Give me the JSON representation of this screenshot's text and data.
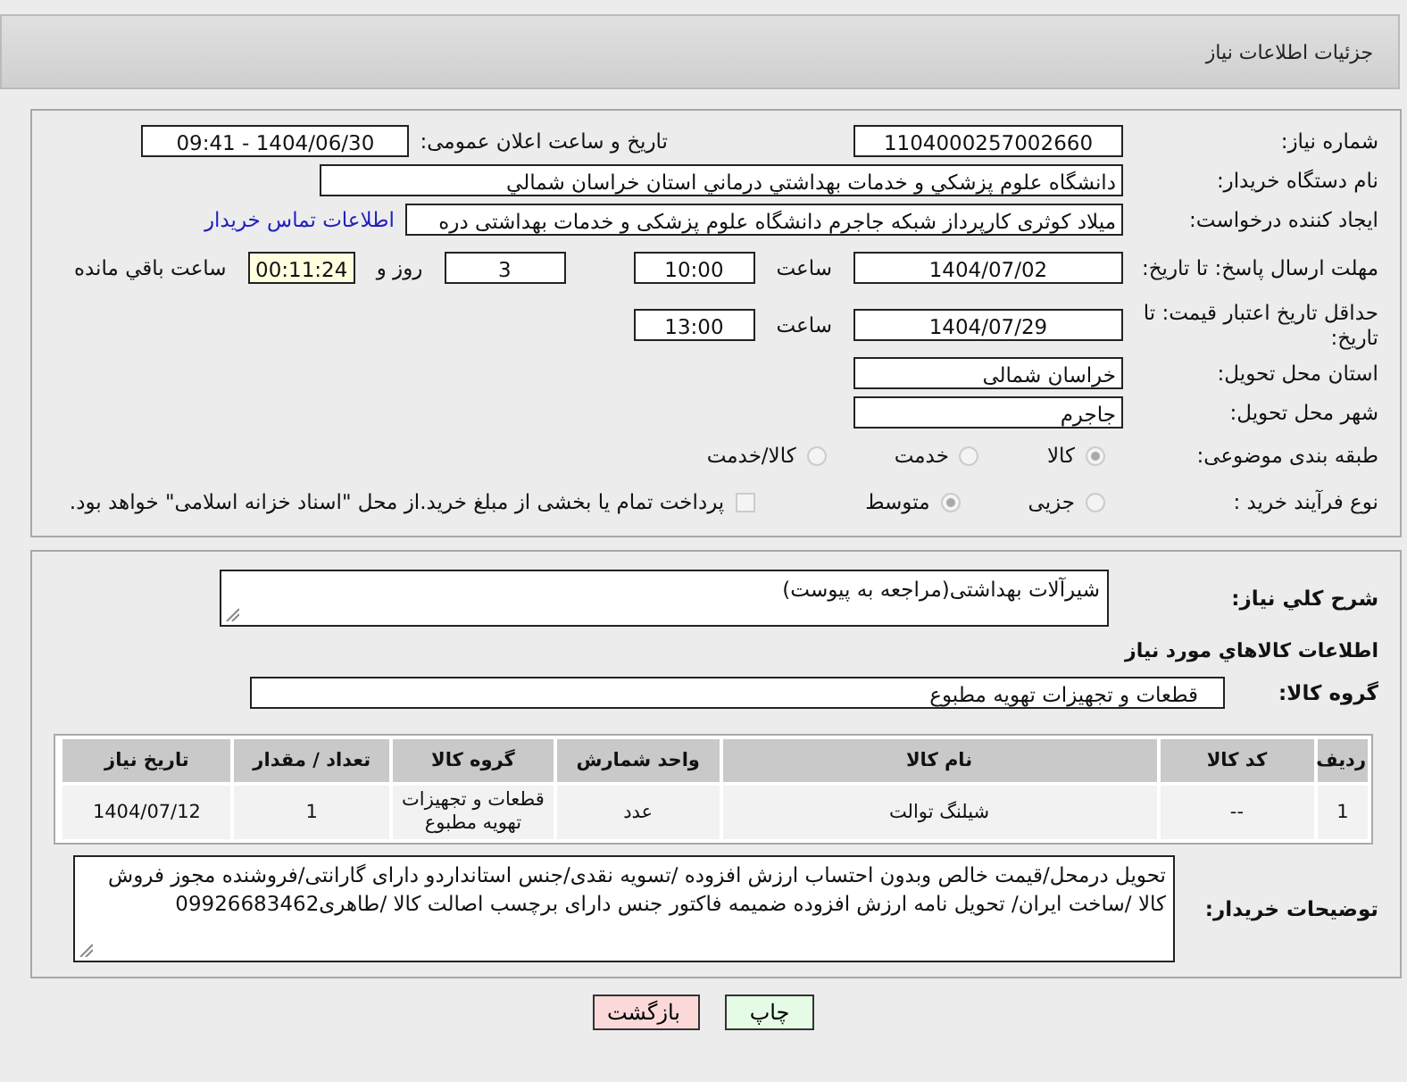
{
  "header": {
    "title": "جزئیات اطلاعات نیاز"
  },
  "details": {
    "need_number": {
      "label": "شماره نیاز:",
      "value": "1104000257002660"
    },
    "announce": {
      "label": "تاریخ و ساعت اعلان عمومی:",
      "value": "1404/06/30 - 09:41"
    },
    "buyer": {
      "label": "نام دستگاه خریدار:",
      "value": "دانشگاه علوم پزشکي و خدمات بهداشتي درماني استان خراسان شمالي"
    },
    "requester": {
      "label": "ایجاد کننده درخواست:",
      "value": "میلاد کوثری کارپرداز شبکه جاجرم دانشگاه علوم پزشکی و خدمات بهداشتی دره",
      "link": "اطلاعات تماس خریدار"
    },
    "deadline": {
      "label": "مهلت ارسال پاسخ: تا تاریخ:",
      "date": "1404/07/02",
      "time_label": "ساعت",
      "time": "10:00",
      "days": "3",
      "days_label": "روز و",
      "remaining": "00:11:24",
      "remaining_label": "ساعت باقي مانده"
    },
    "validity": {
      "label": "حداقل تاریخ اعتبار قیمت: تا تاریخ:",
      "date": "1404/07/29",
      "time_label": "ساعت",
      "time": "13:00"
    },
    "province": {
      "label": "استان محل تحویل:",
      "value": "خراسان شمالی"
    },
    "city": {
      "label": "شهر محل تحویل:",
      "value": "جاجرم"
    },
    "category": {
      "label": "طبقه بندی موضوعی:",
      "options": [
        {
          "label": "كالا",
          "selected": true
        },
        {
          "label": "خدمت",
          "selected": false
        },
        {
          "label": "كالا/خدمت",
          "selected": false
        }
      ]
    },
    "process": {
      "label": "نوع فرآیند خرید :",
      "options": [
        {
          "label": "جزیی",
          "selected": false
        },
        {
          "label": "متوسط",
          "selected": true
        }
      ],
      "payment": {
        "label": "پرداخت تمام یا بخشی از مبلغ خرید.از محل \"اسناد خزانه اسلامی\" خواهد بود.",
        "checked": false
      }
    }
  },
  "goods": {
    "description": {
      "label": "شرح کلي نياز:",
      "value": "شیرآلات بهداشتی(مراجعه به پیوست)"
    },
    "heading": "اطلاعات كالاهاي مورد نياز",
    "group": {
      "label": "گروه کالا:",
      "value": "قطعات و تجهیزات تهویه مطبوع"
    },
    "table": {
      "columns": [
        "ردیف",
        "کد کالا",
        "نام کالا",
        "واحد شمارش",
        "گروه کالا",
        "تعداد / مقدار",
        "تاریخ نیاز"
      ],
      "rows": [
        [
          "1",
          "--",
          "شیلنگ توالت",
          "عدد",
          "قطعات و تجهیزات تهویه مطبوع",
          "1",
          "1404/07/12"
        ]
      ]
    },
    "notes": {
      "label": "توضیحات خریدار:",
      "value": "تحویل درمحل/قیمت خالص وبدون احتساب ارزش افزوده /تسویه نقدی/جنس استانداردو دارای گارانتی/فروشنده مجوز فروش کالا /ساخت ایران/ تحویل  نامه ارزش افزوده ضمیمه  فاکتور جنس دارای برچسب اصالت کالا /طاهری09926683462"
    }
  },
  "buttons": [
    {
      "kind": "print",
      "label": "چاپ"
    },
    {
      "kind": "back",
      "label": "بازگشت"
    }
  ]
}
